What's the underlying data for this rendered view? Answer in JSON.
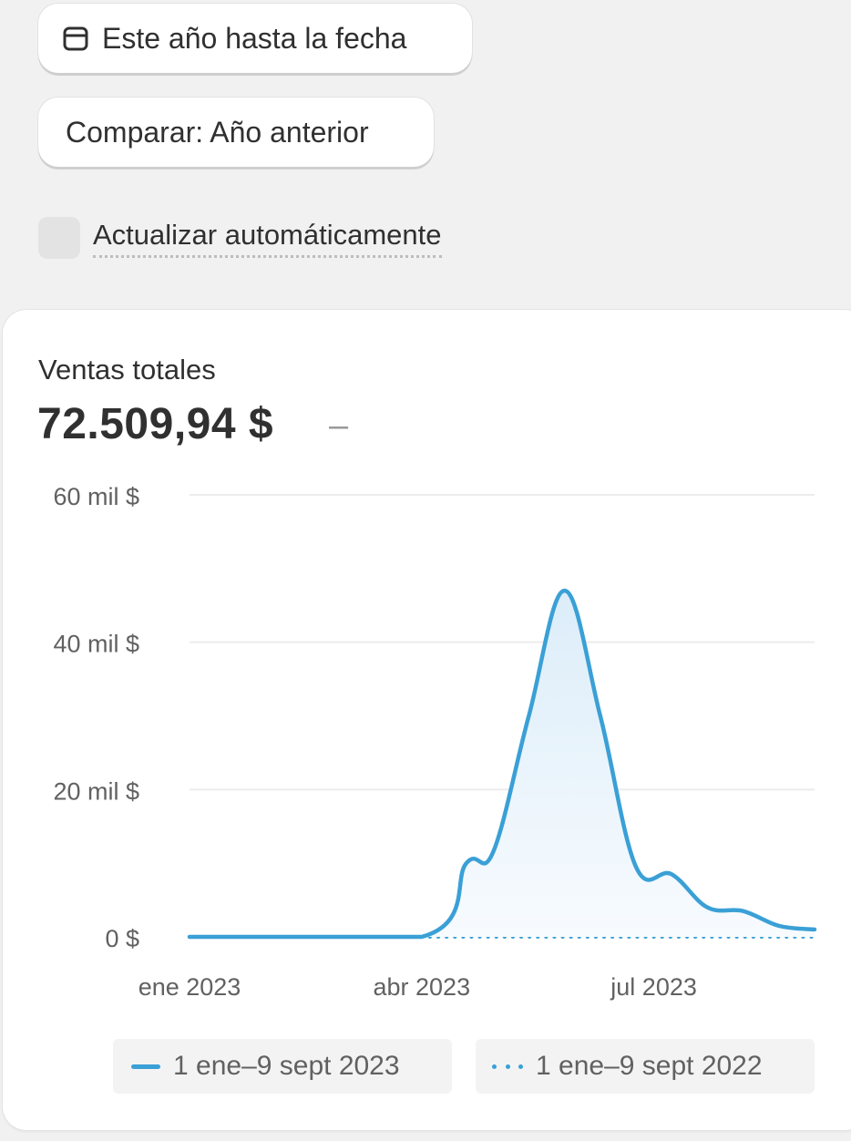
{
  "controls": {
    "date_range_label": "Este año hasta la fecha",
    "date_range_icon": "calendar-icon",
    "compare_label": "Comparar: Año anterior",
    "auto_update_label": "Actualizar automáticamente",
    "auto_update_checked": false
  },
  "metric": {
    "title": "Ventas totales",
    "value": "72.509,94 $",
    "change": "–"
  },
  "colors": {
    "accent": "#3aa0d6",
    "fill": "#e8f3fb",
    "grid": "#ececec"
  },
  "chart_data": {
    "type": "area",
    "y_tick_labels": [
      "0 $",
      "20 mil $",
      "40 mil $",
      "60 mil $"
    ],
    "y_ticks": [
      0,
      20000,
      40000,
      60000
    ],
    "ylim": [
      0,
      60000
    ],
    "x_tick_labels": [
      "ene 2023",
      "abr 2023",
      "jul 2023"
    ],
    "x_tick_positions": [
      0,
      13,
      26
    ],
    "x_range": [
      0,
      35
    ],
    "grid": true,
    "legend_position": "bottom",
    "series": [
      {
        "name": "1 ene–9 sept 2023",
        "style": "solid",
        "points": [
          [
            0,
            0
          ],
          [
            13,
            0
          ],
          [
            15.5,
            10000
          ],
          [
            17,
            11500
          ],
          [
            19,
            30000
          ],
          [
            21,
            47000
          ],
          [
            23,
            30000
          ],
          [
            25,
            9500
          ],
          [
            27,
            8500
          ],
          [
            29,
            4000
          ],
          [
            31,
            3500
          ],
          [
            33,
            1500
          ],
          [
            35,
            1000
          ]
        ]
      },
      {
        "name": "1 ene–9 sept 2022",
        "style": "dotted",
        "points": [
          [
            13,
            0
          ],
          [
            35,
            0
          ]
        ]
      }
    ]
  }
}
